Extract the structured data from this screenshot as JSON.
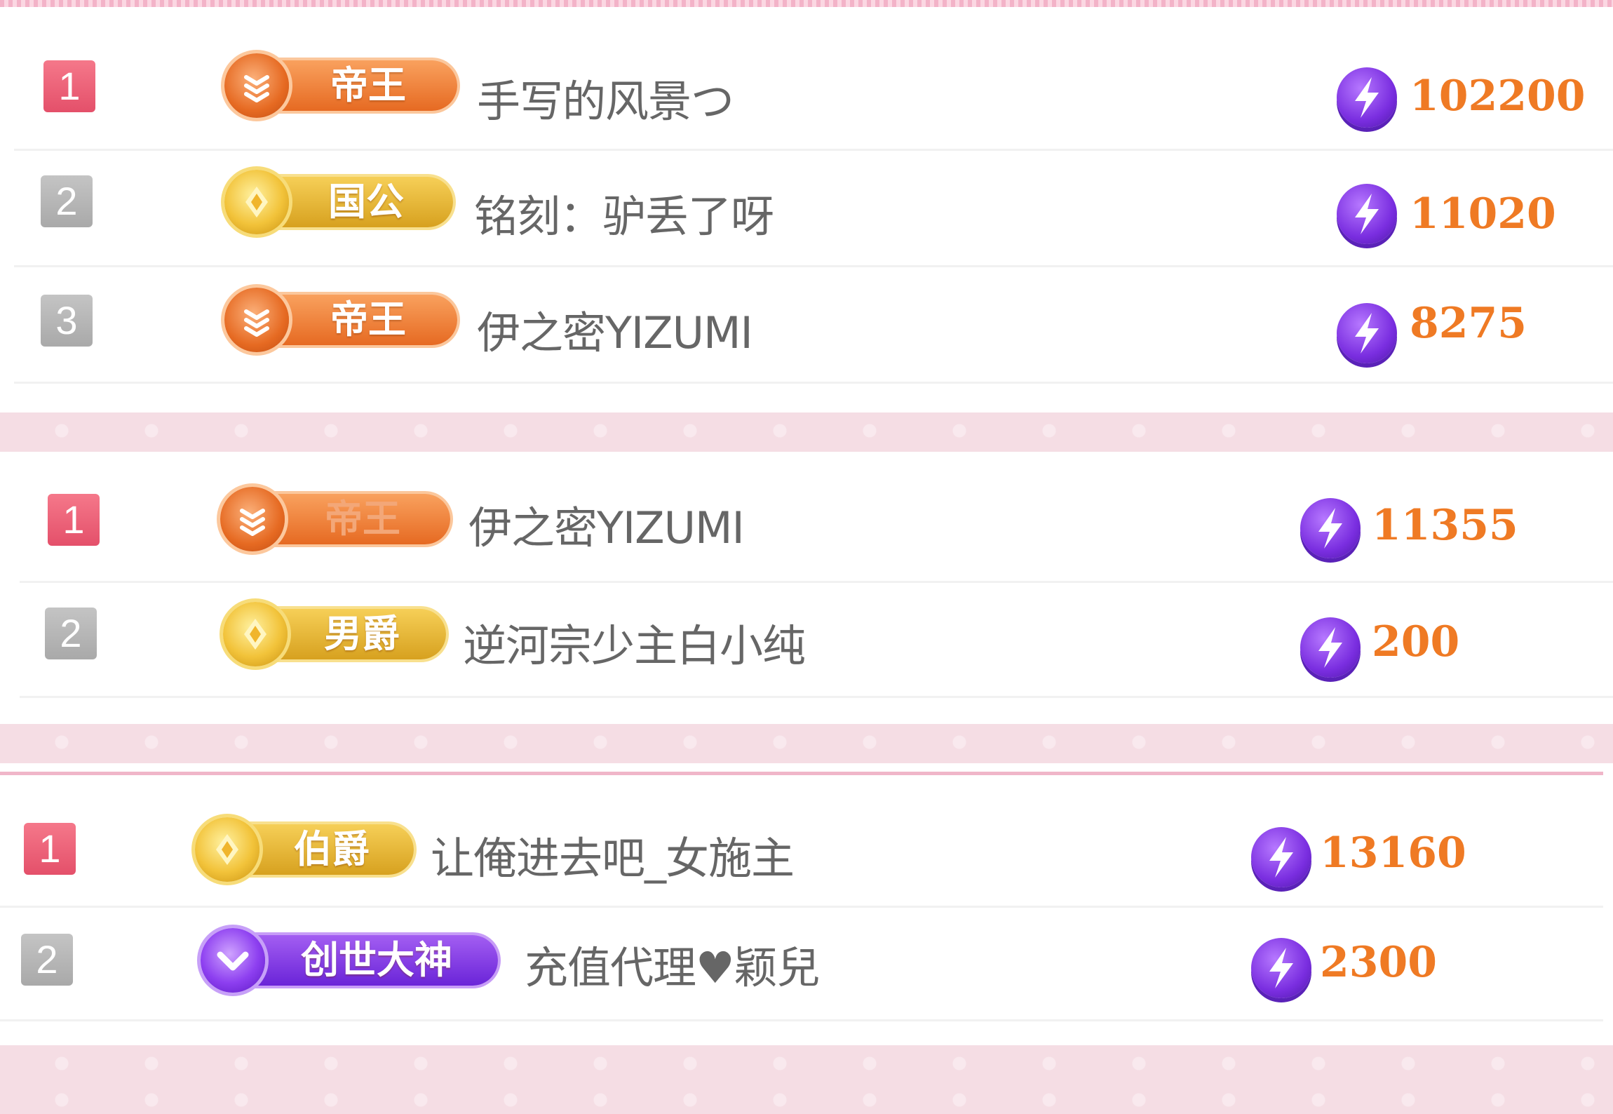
{
  "colors": {
    "rank_first": "#e4506a",
    "rank_other": "#aaaaaa",
    "score": "#ef7a24",
    "band": "#f5dde4"
  },
  "boards": [
    {
      "rows": [
        {
          "rank": "1",
          "badge": "帝王",
          "badge_style": "orange",
          "name": "手写的风景つ",
          "score": "102200"
        },
        {
          "rank": "2",
          "badge": "国公",
          "badge_style": "gold",
          "name": "铭刻：驴丢了呀",
          "score": "11020"
        },
        {
          "rank": "3",
          "badge": "帝王",
          "badge_style": "orange",
          "name": "伊之密YIZUMI",
          "score": "8275"
        }
      ]
    },
    {
      "rows": [
        {
          "rank": "1",
          "badge": "帝王",
          "badge_style": "orange",
          "name": "伊之密YIZUMI",
          "score": "11355"
        },
        {
          "rank": "2",
          "badge": "男爵",
          "badge_style": "gold",
          "name": "逆河宗少主白小纯",
          "score": "200"
        }
      ]
    },
    {
      "rows": [
        {
          "rank": "1",
          "badge": "伯爵",
          "badge_style": "gold",
          "name": "让俺进去吧_女施主",
          "score": "13160"
        },
        {
          "rank": "2",
          "badge": "创世大神",
          "badge_style": "purple",
          "name": "充值代理♥颖兒",
          "score": "2300"
        }
      ]
    }
  ]
}
